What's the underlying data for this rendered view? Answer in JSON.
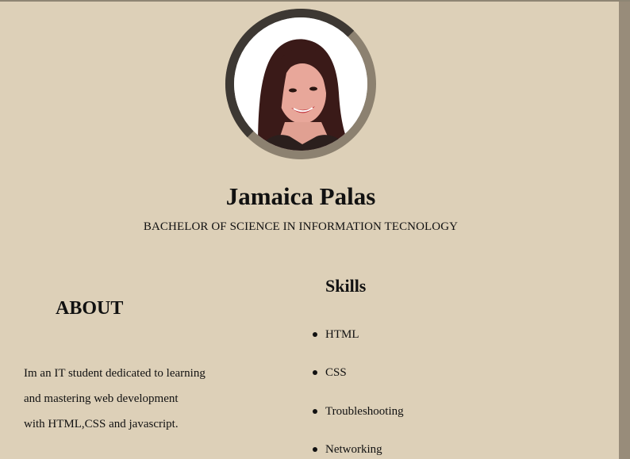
{
  "profile": {
    "name": "Jamaica Palas",
    "degree": "BACHELOR OF SCIENCE IN INFORMATION TECNOLOGY",
    "photo_icon": "profile-photo"
  },
  "about": {
    "title": "ABOUT",
    "lines": [
      "Im an IT student dedicated to learning",
      "and mastering web development",
      "with HTML,CSS and javascript."
    ]
  },
  "skills": {
    "title": "Skills",
    "items": [
      "HTML",
      "CSS",
      "Troubleshooting",
      "Networking"
    ]
  },
  "colors": {
    "background": "#ddd0b8",
    "ring_dark": "#3d3833",
    "ring_light": "#8c8170",
    "scrollbar": "#988c7a"
  }
}
